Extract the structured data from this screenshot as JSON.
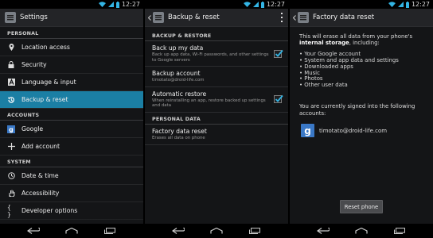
{
  "status": {
    "clock": "12:27"
  },
  "screen1": {
    "title": "Settings",
    "sections": [
      {
        "header": "PERSONAL",
        "items": [
          {
            "label": "Location access",
            "icon": "location-icon"
          },
          {
            "label": "Security",
            "icon": "lock-icon"
          },
          {
            "label": "Language & input",
            "icon": "keyboard-icon"
          },
          {
            "label": "Backup & reset",
            "icon": "backup-icon",
            "selected": true
          }
        ]
      },
      {
        "header": "ACCOUNTS",
        "items": [
          {
            "label": "Google",
            "icon": "google-icon"
          },
          {
            "label": "Add account",
            "icon": "plus-icon"
          }
        ]
      },
      {
        "header": "SYSTEM",
        "items": [
          {
            "label": "Date & time",
            "icon": "clock-icon"
          },
          {
            "label": "Accessibility",
            "icon": "hand-icon"
          },
          {
            "label": "Developer options",
            "icon": "braces-icon"
          }
        ]
      }
    ],
    "selected_color": "#1b7fa4"
  },
  "screen2": {
    "title": "Backup & reset",
    "section1": "BACKUP & RESTORE",
    "backup_data": {
      "title": "Back up my data",
      "summary": "Back up app data, Wi-Fi passwords, and other settings to Google servers",
      "checked": true
    },
    "backup_account": {
      "title": "Backup account",
      "summary": "timotato@droid-life.com"
    },
    "auto_restore": {
      "title": "Automatic restore",
      "summary": "When reinstalling an app, restore backed up settings and data",
      "checked": true
    },
    "section2": "PERSONAL DATA",
    "factory_reset": {
      "title": "Factory data reset",
      "summary": "Erases all data on phone"
    }
  },
  "screen3": {
    "title": "Factory data reset",
    "intro_prefix": "This will erase all data from your phone's",
    "intro_bold": "internal storage",
    "intro_suffix": ", including:",
    "bullets": [
      "• Your Google account",
      "• System and app data and settings",
      "• Downloaded apps",
      "• Music",
      "• Photos",
      "• Other user data"
    ],
    "signed_in": "You are currently signed into the following accounts:",
    "account": "timotato@droid-life.com",
    "google_letter": "g",
    "reset_button": "Reset phone"
  }
}
